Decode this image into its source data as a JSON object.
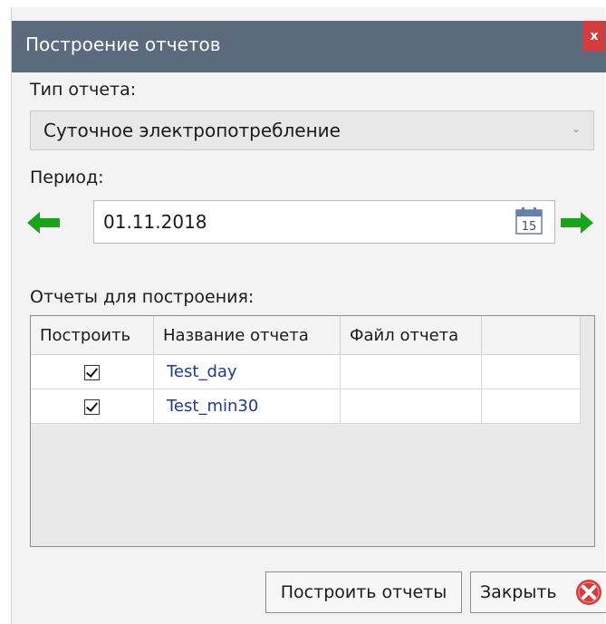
{
  "window": {
    "title": "Построение отчетов",
    "close_label": "x"
  },
  "report_type": {
    "label": "Тип отчета:",
    "value": "Суточное электропотребление"
  },
  "period": {
    "label": "Период:",
    "date_value": "01.11.2018",
    "calendar_day": "15"
  },
  "reports": {
    "label": "Отчеты для построения:",
    "columns": [
      "Построить",
      "Название отчета",
      "Файл отчета"
    ],
    "rows": [
      {
        "build": true,
        "name": "Test_day",
        "file": ""
      },
      {
        "build": true,
        "name": "Test_min30",
        "file": ""
      }
    ]
  },
  "buttons": {
    "build_label": "Построить отчеты",
    "close_label": "Закрыть"
  },
  "colors": {
    "titlebar": "#5b6b7d",
    "close_red": "#d33d3d",
    "arrow_green": "#18a418",
    "link_blue": "#1f3a8a"
  },
  "icons": {
    "prev": "arrow-left-icon",
    "next": "arrow-right-icon",
    "calendar": "calendar-icon",
    "close": "close-circle-icon"
  }
}
